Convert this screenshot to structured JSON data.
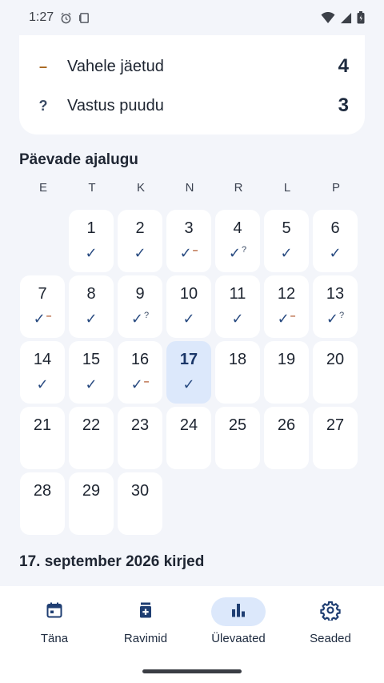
{
  "status_bar": {
    "time": "1:27"
  },
  "summary": {
    "rows": [
      {
        "mark": "–",
        "label": "Vahele jäetud",
        "count": "4"
      },
      {
        "mark": "?",
        "label": "Vastus puudu",
        "count": "3"
      }
    ]
  },
  "history": {
    "title": "Päevade ajalugu",
    "weekdays": [
      "E",
      "T",
      "K",
      "N",
      "R",
      "L",
      "P"
    ],
    "check_glyph": "✓",
    "skip_glyph": "–",
    "missing_glyph": "?",
    "selected_day": 17,
    "days": [
      {
        "n": "1",
        "marks": [
          "check"
        ]
      },
      {
        "n": "2",
        "marks": [
          "check"
        ]
      },
      {
        "n": "3",
        "marks": [
          "check",
          "skip"
        ]
      },
      {
        "n": "4",
        "marks": [
          "check",
          "missing"
        ]
      },
      {
        "n": "5",
        "marks": [
          "check"
        ]
      },
      {
        "n": "6",
        "marks": [
          "check"
        ]
      },
      {
        "n": "7",
        "marks": [
          "check",
          "skip"
        ]
      },
      {
        "n": "8",
        "marks": [
          "check"
        ]
      },
      {
        "n": "9",
        "marks": [
          "check",
          "missing"
        ]
      },
      {
        "n": "10",
        "marks": [
          "check"
        ]
      },
      {
        "n": "11",
        "marks": [
          "check"
        ]
      },
      {
        "n": "12",
        "marks": [
          "check",
          "skip"
        ]
      },
      {
        "n": "13",
        "marks": [
          "check",
          "missing"
        ]
      },
      {
        "n": "14",
        "marks": [
          "check"
        ]
      },
      {
        "n": "15",
        "marks": [
          "check"
        ]
      },
      {
        "n": "16",
        "marks": [
          "check",
          "skip"
        ]
      },
      {
        "n": "17",
        "marks": [
          "check"
        ]
      },
      {
        "n": "18",
        "marks": []
      },
      {
        "n": "19",
        "marks": []
      },
      {
        "n": "20",
        "marks": []
      },
      {
        "n": "21",
        "marks": []
      },
      {
        "n": "22",
        "marks": []
      },
      {
        "n": "23",
        "marks": []
      },
      {
        "n": "24",
        "marks": []
      },
      {
        "n": "25",
        "marks": []
      },
      {
        "n": "26",
        "marks": []
      },
      {
        "n": "27",
        "marks": []
      },
      {
        "n": "28",
        "marks": []
      },
      {
        "n": "29",
        "marks": []
      },
      {
        "n": "30",
        "marks": []
      }
    ]
  },
  "entries": {
    "title": "17. september 2026 kirjed"
  },
  "nav": {
    "items": [
      {
        "label": "Täna",
        "icon": "calendar-icon",
        "active": false
      },
      {
        "label": "Ravimid",
        "icon": "medication-icon",
        "active": false
      },
      {
        "label": "Ülevaated",
        "icon": "bar-chart-icon",
        "active": true
      },
      {
        "label": "Seaded",
        "icon": "gear-icon",
        "active": false
      }
    ]
  },
  "colors": {
    "accent": "#284a80",
    "selected_bg": "#dce8fb",
    "skip": "#b0572c",
    "background": "#f3f5fa"
  }
}
